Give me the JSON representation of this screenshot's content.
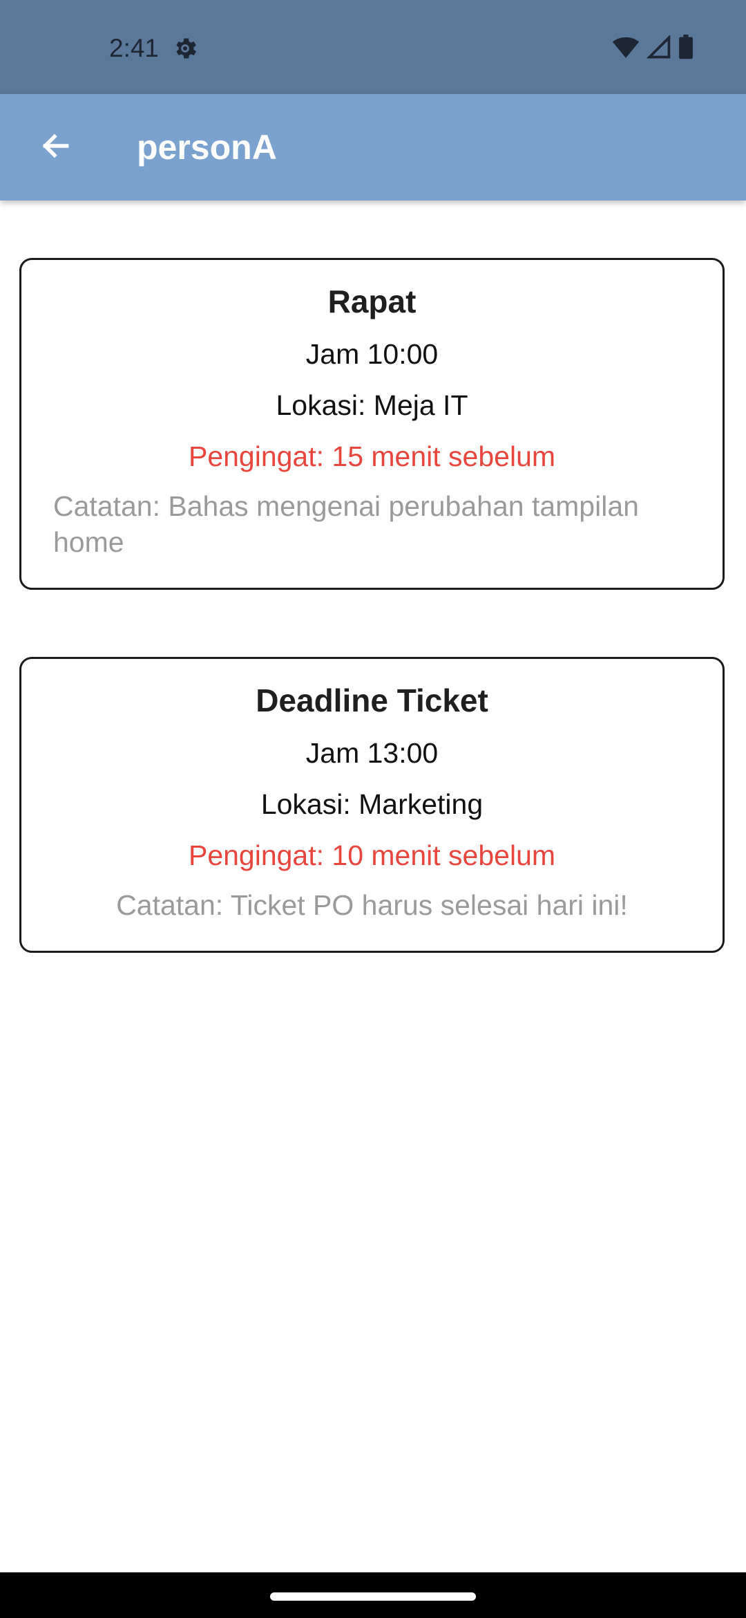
{
  "status_bar": {
    "time": "2:41",
    "left_icons": [
      "settings-gear-icon"
    ],
    "right_icons": [
      "wifi-icon",
      "cell-signal-icon",
      "battery-icon"
    ]
  },
  "app_bar": {
    "title": "personA",
    "back_icon": "arrow-left-icon"
  },
  "events": [
    {
      "title": "Rapat",
      "time": "Jam 10:00",
      "location": "Lokasi: Meja IT",
      "reminder": "Pengingat: 15 menit sebelum",
      "note": "Catatan: Bahas mengenai perubahan tampilan home"
    },
    {
      "title": "Deadline Ticket",
      "time": "Jam 13:00",
      "location": "Lokasi: Marketing",
      "reminder": "Pengingat: 10 menit sebelum",
      "note": "Catatan: Ticket PO harus selesai hari ini!"
    }
  ],
  "colors": {
    "status_bar": "#5c7899",
    "app_bar": "#7ba2cf",
    "reminder": "#e8453c",
    "note": "#9a9a9a"
  }
}
